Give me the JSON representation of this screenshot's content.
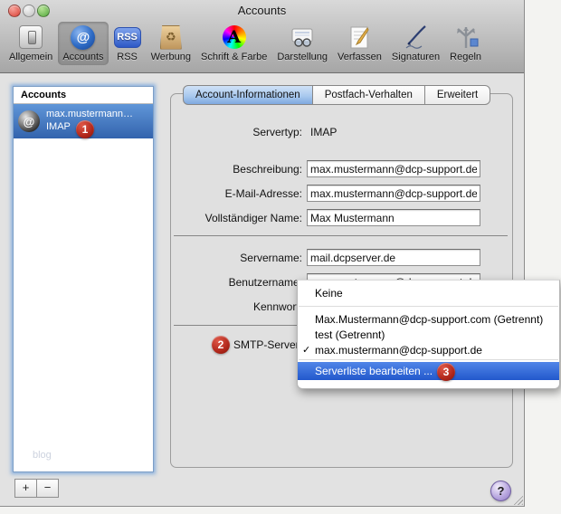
{
  "window": {
    "title": "Accounts"
  },
  "toolbar": {
    "items": [
      {
        "label": "Allgemein",
        "icon": "switch-icon",
        "selected": false
      },
      {
        "label": "Accounts",
        "icon": "at-sphere-icon",
        "selected": true
      },
      {
        "label": "RSS",
        "icon": "rss-icon",
        "selected": false
      },
      {
        "label": "Werbung",
        "icon": "bag-icon",
        "selected": false
      },
      {
        "label": "Schrift & Farbe",
        "icon": "letter-a-rainbow-icon",
        "selected": false
      },
      {
        "label": "Darstellung",
        "icon": "glasses-icon",
        "selected": false
      },
      {
        "label": "Verfassen",
        "icon": "pencil-icon",
        "selected": false
      },
      {
        "label": "Signaturen",
        "icon": "pen-icon",
        "selected": false
      },
      {
        "label": "Regeln",
        "icon": "branch-arrows-icon",
        "selected": false
      }
    ]
  },
  "icons": {
    "at": "@",
    "rss": "RSS",
    "recycle": "♻",
    "letter_a": "A",
    "check": "✓",
    "plus": "+",
    "minus": "−",
    "help": "?"
  },
  "sidebar": {
    "header": "Accounts",
    "account": {
      "name": "max.mustermann…",
      "type": "IMAP"
    },
    "watermark": "blog"
  },
  "tabs": [
    {
      "label": "Account-Informationen",
      "selected": true
    },
    {
      "label": "Postfach-Verhalten",
      "selected": false
    },
    {
      "label": "Erweitert",
      "selected": false
    }
  ],
  "form": {
    "servertyp_label": "Servertyp:",
    "servertyp_value": "IMAP",
    "fields": [
      {
        "label": "Beschreibung:",
        "value": "max.mustermann@dcp-support.de"
      },
      {
        "label": "E-Mail-Adresse:",
        "value": "max.mustermann@dcp-support.de"
      },
      {
        "label": "Vollständiger Name:",
        "value": "Max Mustermann"
      },
      {
        "label": "Servername:",
        "value": "mail.dcpserver.de"
      },
      {
        "label": "Benutzername:",
        "value": "max.mustermann@dcp-support.de"
      },
      {
        "label": "Kennwort:",
        "value": ""
      }
    ],
    "smtp_label": "SMTP-Server:"
  },
  "menu": {
    "items": [
      {
        "label": "Keine",
        "checked": false,
        "highlighted": false
      },
      {
        "label": "Max.Mustermann@dcp-support.com (Getrennt)",
        "checked": false,
        "highlighted": false
      },
      {
        "label": "test (Getrennt)",
        "checked": false,
        "highlighted": false
      },
      {
        "label": "max.mustermann@dcp-support.de",
        "checked": true,
        "highlighted": false
      },
      {
        "label": "Serverliste bearbeiten ...",
        "checked": false,
        "highlighted": true
      }
    ]
  },
  "annotations": {
    "badge1": "1",
    "badge2": "2",
    "badge3": "3"
  },
  "colors": {
    "selection_blue": "#3263ad",
    "menu_highlight": "#2d64d9",
    "tab_selected": "#a9c9ee",
    "badge_red": "#b1271b",
    "help_purple": "#9d86cc",
    "focus_ring": "#6f9fd8"
  }
}
